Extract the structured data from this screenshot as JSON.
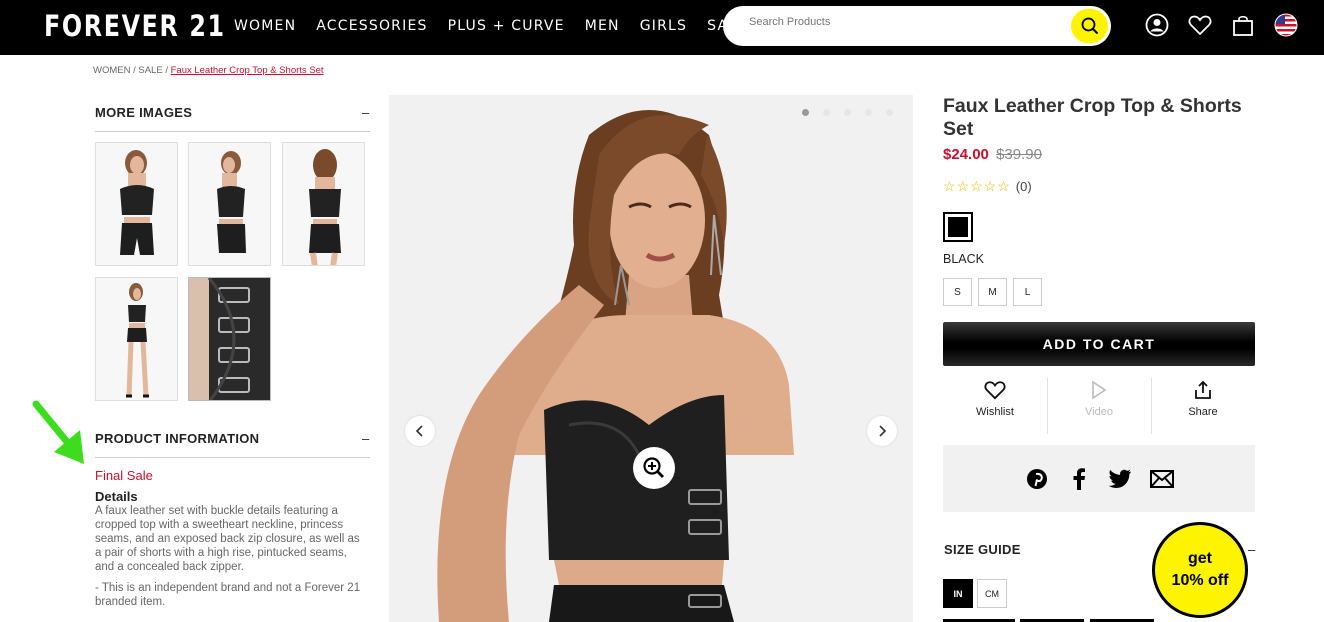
{
  "header": {
    "logo": "FOREVER 21",
    "nav": [
      "WOMEN",
      "ACCESSORIES",
      "PLUS + CURVE",
      "MEN",
      "GIRLS",
      "SALE"
    ],
    "search_placeholder": "Search Products"
  },
  "breadcrumb": {
    "part1": "WOMEN / SALE / ",
    "current": "Faux Leather Crop Top & Shorts Set"
  },
  "more_images": {
    "title": "MORE IMAGES",
    "toggle": "–",
    "count": 5
  },
  "product_info": {
    "title": "PRODUCT INFORMATION",
    "toggle": "–",
    "final_sale": "Final Sale",
    "details_heading": "Details",
    "details_text": "A faux leather set with buckle details featuring a cropped top with a sweetheart neckline, princess seams, and an exposed back zip closure, as well as a pair of shorts with a high rise, pintucked seams, and a concealed back zipper.",
    "details_note": "- This is an independent brand and not a Forever 21 branded item."
  },
  "gallery": {
    "slides": 5,
    "active_slide": 1
  },
  "product": {
    "title": "Faux Leather Crop Top & Shorts Set",
    "sale_price": "$24.00",
    "original_price": "$39.90",
    "stars": "☆☆☆☆☆",
    "review_count": "(0)",
    "color": "BLACK",
    "sizes": [
      "S",
      "M",
      "L"
    ],
    "add_to_cart": "ADD TO CART",
    "actions": {
      "wishlist": "Wishlist",
      "video": "Video",
      "share": "Share"
    }
  },
  "size_guide": {
    "title": "SIZE GUIDE",
    "toggle": "–",
    "units": [
      "IN",
      "CM"
    ],
    "active_unit": "IN"
  },
  "promo": {
    "line1": "get",
    "line2": "10% off"
  },
  "colors": {
    "brand_yellow": "#fef300",
    "sale_red": "#c8102e",
    "annotation_green": "#3ddc1e"
  }
}
